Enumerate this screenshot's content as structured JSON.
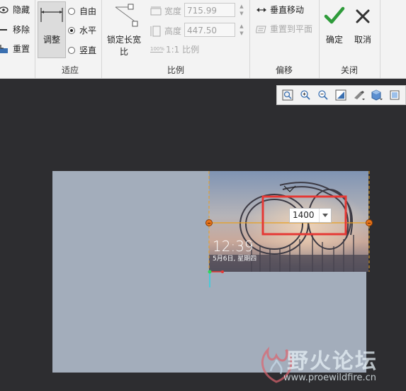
{
  "ribbon": {
    "display_group": {
      "hide_label": "隐藏",
      "remove_label": "移除",
      "reset_label": "重置"
    },
    "fit_group": {
      "adjust_label": "调整",
      "free_label": "自由",
      "horizontal_label": "水平",
      "vertical_label": "竖直",
      "group_label": "适应",
      "selected": "水平"
    },
    "ratio_group": {
      "lock_label_line1": "锁定长宽",
      "lock_label_line2": "比",
      "width_label": "宽度",
      "width_value": "715.99",
      "height_label": "高度",
      "height_value": "447.50",
      "ratio_label": "1:1 比例",
      "ratio_icon_text": "100%",
      "group_label": "比例"
    },
    "offset_group": {
      "vertical_move_label": "垂直移动",
      "reset_to_plane_label": "重置到平面",
      "group_label": "偏移"
    },
    "close_group": {
      "ok_label": "确定",
      "cancel_label": "取消",
      "group_label": "关闭"
    }
  },
  "view_toolbar": {
    "icons": [
      "zoom-fit-icon",
      "zoom-in-icon",
      "zoom-out-icon",
      "repaint-icon",
      "view-orientation-icon",
      "display-style-icon",
      "saved-views-icon"
    ]
  },
  "image_overlay": {
    "time": "12:39",
    "date": "5月6日, 星期四"
  },
  "dimension_input": {
    "value": "1400"
  },
  "watermark": {
    "text": "野火论坛",
    "url": "www.proewildfire.cn"
  },
  "colors": {
    "ribbon_bg": "#f3f3f3",
    "workspace_bg": "#2d2d30",
    "canvas_bg": "#a3adbb",
    "highlight_red": "#e53935",
    "ok_green": "#2e9b3a",
    "handle_orange": "#e8741a"
  }
}
